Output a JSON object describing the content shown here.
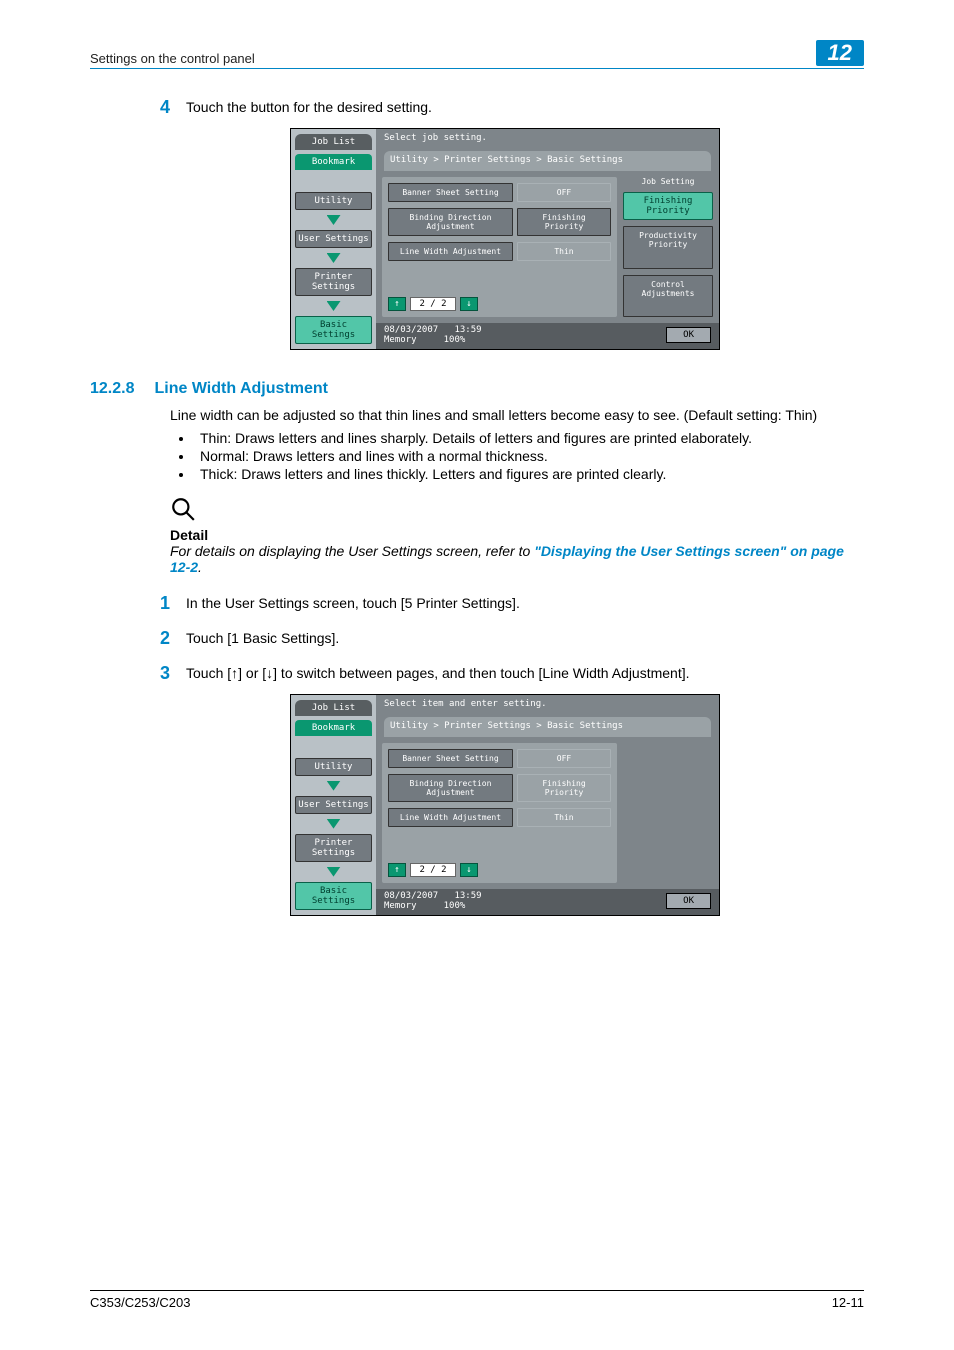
{
  "header": {
    "left": "Settings on the control panel",
    "chapter": "12"
  },
  "step4": {
    "num": "4",
    "text": "Touch the button for the desired setting."
  },
  "panel1": {
    "instruction": "Select job setting.",
    "breadcrumb": "Utility > Printer Settings > Basic Settings",
    "left": {
      "job_list": "Job List",
      "bookmark": "Bookmark",
      "utility": "Utility",
      "user_settings": "User Settings",
      "printer_settings": "Printer Settings",
      "basic_settings": "Basic Settings"
    },
    "rows": [
      {
        "label": "Banner Sheet Setting",
        "value": "OFF"
      },
      {
        "label": "Binding Direction Adjustment",
        "value": "Finishing Priority"
      },
      {
        "label": "Line Width Adjustment",
        "value": "Thin"
      }
    ],
    "pager": "2 / 2",
    "side": {
      "title": "Job Setting",
      "finishing": "Finishing Priority",
      "productivity": "Productivity\nPriority",
      "control": "Control\nAdjustments"
    },
    "footer": {
      "date": "08/03/2007",
      "time": "13:59",
      "memory": "Memory",
      "mempct": "100%",
      "ok": "OK"
    }
  },
  "section": {
    "num": "12.2.8",
    "title": "Line Width Adjustment"
  },
  "intro": "Line width can be adjusted so that thin lines and small letters become easy to see. (Default setting: Thin)",
  "bullets": {
    "a": "Thin: Draws letters and lines sharply. Details of letters and figures are printed elaborately.",
    "b": "Normal: Draws letters and lines with a normal thickness.",
    "c": "Thick: Draws letters and lines thickly. Letters and figures are printed clearly."
  },
  "detail": {
    "head": "Detail",
    "lead": "For details on displaying the User Settings screen, refer to ",
    "ref": "\"Displaying the User Settings screen\" on page 12-2",
    "tail": "."
  },
  "step1": {
    "num": "1",
    "text": "In the User Settings screen, touch [5 Printer Settings]."
  },
  "step2": {
    "num": "2",
    "text": "Touch [1 Basic Settings]."
  },
  "step3": {
    "num": "3",
    "text": "Touch [↑] or [↓] to switch between pages, and then touch [Line Width Adjustment]."
  },
  "panel2": {
    "instruction": "Select item and enter setting.",
    "breadcrumb": "Utility > Printer Settings > Basic Settings",
    "left": {
      "job_list": "Job List",
      "bookmark": "Bookmark",
      "utility": "Utility",
      "user_settings": "User Settings",
      "printer_settings": "Printer Settings",
      "basic_settings": "Basic Settings"
    },
    "rows": [
      {
        "label": "Banner Sheet Setting",
        "value": "OFF"
      },
      {
        "label": "Binding Direction Adjustment",
        "value": "Finishing Priority"
      },
      {
        "label": "Line Width Adjustment",
        "value": "Thin"
      }
    ],
    "pager": "2 / 2",
    "footer": {
      "date": "08/03/2007",
      "time": "13:59",
      "memory": "Memory",
      "mempct": "100%",
      "ok": "OK"
    }
  },
  "footer": {
    "left": "C353/C253/C203",
    "right": "12-11"
  }
}
